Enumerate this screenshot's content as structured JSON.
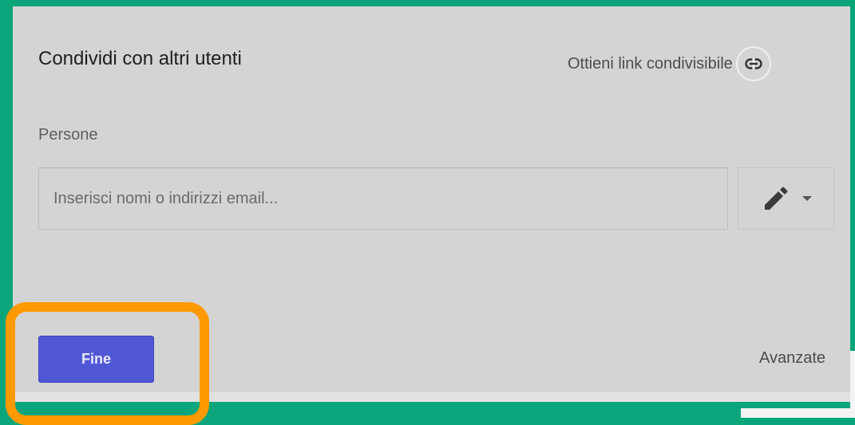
{
  "dialog": {
    "title": "Condividi con altri utenti",
    "share_link": {
      "label": "Ottieni link condivisibile",
      "icon": "link-icon"
    },
    "people": {
      "label": "Persone",
      "input_placeholder": "Inserisci nomi o indirizzi email...",
      "input_value": ""
    },
    "permission_button": {
      "icon": "pencil-icon",
      "dropdown_icon": "caret-down-icon"
    },
    "buttons": {
      "done_label": "Fine",
      "advanced_label": "Avanzate"
    }
  },
  "colors": {
    "background": "#0aa57a",
    "dialog": "#d4d4d4",
    "primary_button": "#5158d6",
    "highlight": "#ff9900"
  }
}
